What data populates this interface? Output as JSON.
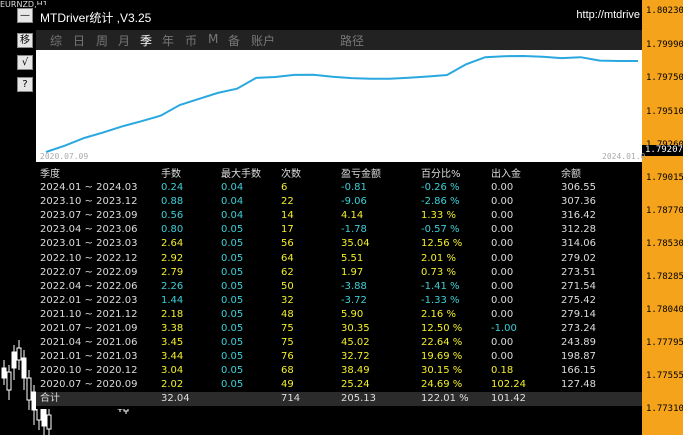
{
  "chart_window": {
    "symbol": "EURNZD,H1",
    "price_ticks": [
      "1.80230",
      "1.79990",
      "1.79750",
      "1.79510",
      "1.79260",
      "1.79015",
      "1.78770",
      "1.78530",
      "1.78285",
      "1.78040",
      "1.77795",
      "1.77555",
      "1.77310"
    ],
    "current_price": "1.79207",
    "side_buttons": [
      "—",
      "移",
      "√",
      "?"
    ]
  },
  "panel": {
    "title": "MTDriver统计 ,V3.25",
    "url": "http://mtdrive",
    "tabs": [
      {
        "label": "综",
        "active": false
      },
      {
        "label": "日",
        "active": false
      },
      {
        "label": "周",
        "active": false
      },
      {
        "label": "月",
        "active": false
      },
      {
        "label": "季",
        "active": true
      },
      {
        "label": "年",
        "active": false
      },
      {
        "label": "币",
        "active": false
      },
      {
        "label": "M",
        "active": false
      },
      {
        "label": "备",
        "active": false
      },
      {
        "label": "账户",
        "active": false
      },
      {
        "label": "路径",
        "active": false
      }
    ],
    "equity_chart": {
      "x_start_label": "2020.07.09",
      "x_end_label": "2024.01.0",
      "line_color": "#29a8e0",
      "values": [
        127.48,
        140,
        155,
        166.15,
        178,
        188,
        198.87,
        220,
        232,
        243.89,
        252,
        273.24,
        275,
        279.14,
        279.5,
        275.42,
        273,
        271.54,
        271.8,
        273.51,
        276,
        279.02,
        300,
        314.06,
        316,
        316.42,
        315,
        312.28,
        314,
        307.36,
        306.5,
        306.55
      ]
    },
    "table": {
      "headers": [
        "季度",
        "手数",
        "最大手数",
        "次数",
        "盈亏金额",
        "百分比%",
        "出入金",
        "余额"
      ],
      "rows": [
        {
          "period": "2024.01 ~ 2024.03",
          "lots": "0.24",
          "max": "0.04",
          "count": "6",
          "pnl": "-0.81",
          "pct": "-0.26 %",
          "io": "0.00",
          "bal": "306.55"
        },
        {
          "period": "2023.10 ~ 2023.12",
          "lots": "0.88",
          "max": "0.04",
          "count": "22",
          "pnl": "-9.06",
          "pct": "-2.86 %",
          "io": "0.00",
          "bal": "307.36"
        },
        {
          "period": "2023.07 ~ 2023.09",
          "lots": "0.56",
          "max": "0.04",
          "count": "14",
          "pnl": "4.14",
          "pct": "1.33 %",
          "io": "0.00",
          "bal": "316.42"
        },
        {
          "period": "2023.04 ~ 2023.06",
          "lots": "0.80",
          "max": "0.05",
          "count": "17",
          "pnl": "-1.78",
          "pct": "-0.57 %",
          "io": "0.00",
          "bal": "312.28"
        },
        {
          "period": "2023.01 ~ 2023.03",
          "lots": "2.64",
          "max": "0.05",
          "count": "56",
          "pnl": "35.04",
          "pct": "12.56 %",
          "io": "0.00",
          "bal": "314.06"
        },
        {
          "period": "2022.10 ~ 2022.12",
          "lots": "2.92",
          "max": "0.05",
          "count": "64",
          "pnl": "5.51",
          "pct": "2.01 %",
          "io": "0.00",
          "bal": "279.02"
        },
        {
          "period": "2022.07 ~ 2022.09",
          "lots": "2.79",
          "max": "0.05",
          "count": "62",
          "pnl": "1.97",
          "pct": "0.73 %",
          "io": "0.00",
          "bal": "273.51"
        },
        {
          "period": "2022.04 ~ 2022.06",
          "lots": "2.26",
          "max": "0.05",
          "count": "50",
          "pnl": "-3.88",
          "pct": "-1.41 %",
          "io": "0.00",
          "bal": "271.54"
        },
        {
          "period": "2022.01 ~ 2022.03",
          "lots": "1.44",
          "max": "0.05",
          "count": "32",
          "pnl": "-3.72",
          "pct": "-1.33 %",
          "io": "0.00",
          "bal": "275.42"
        },
        {
          "period": "2021.10 ~ 2021.12",
          "lots": "2.18",
          "max": "0.05",
          "count": "48",
          "pnl": "5.90",
          "pct": "2.16 %",
          "io": "0.00",
          "bal": "279.14"
        },
        {
          "period": "2021.07 ~ 2021.09",
          "lots": "3.38",
          "max": "0.05",
          "count": "75",
          "pnl": "30.35",
          "pct": "12.50 %",
          "io": "-1.00",
          "bal": "273.24"
        },
        {
          "period": "2021.04 ~ 2021.06",
          "lots": "3.45",
          "max": "0.05",
          "count": "75",
          "pnl": "45.02",
          "pct": "22.64 %",
          "io": "0.00",
          "bal": "243.89"
        },
        {
          "period": "2021.01 ~ 2021.03",
          "lots": "3.44",
          "max": "0.05",
          "count": "76",
          "pnl": "32.72",
          "pct": "19.69 %",
          "io": "0.00",
          "bal": "198.87"
        },
        {
          "period": "2020.10 ~ 2020.12",
          "lots": "3.04",
          "max": "0.05",
          "count": "68",
          "pnl": "38.49",
          "pct": "30.15 %",
          "io": "0.18",
          "bal": "166.15"
        },
        {
          "period": "2020.07 ~ 2020.09",
          "lots": "2.02",
          "max": "0.05",
          "count": "49",
          "pnl": "25.24",
          "pct": "24.69 %",
          "io": "102.24",
          "bal": "127.48"
        }
      ],
      "total": {
        "label": "合计",
        "lots": "32.04",
        "count": "714",
        "pnl": "205.13",
        "pct": "122.01 %",
        "io": "101.42"
      }
    }
  },
  "colors": {
    "positive": "#f2ef2a",
    "negative": "#3cd0d8",
    "neutral": "#dddddd",
    "accent": "#f5a31a"
  }
}
